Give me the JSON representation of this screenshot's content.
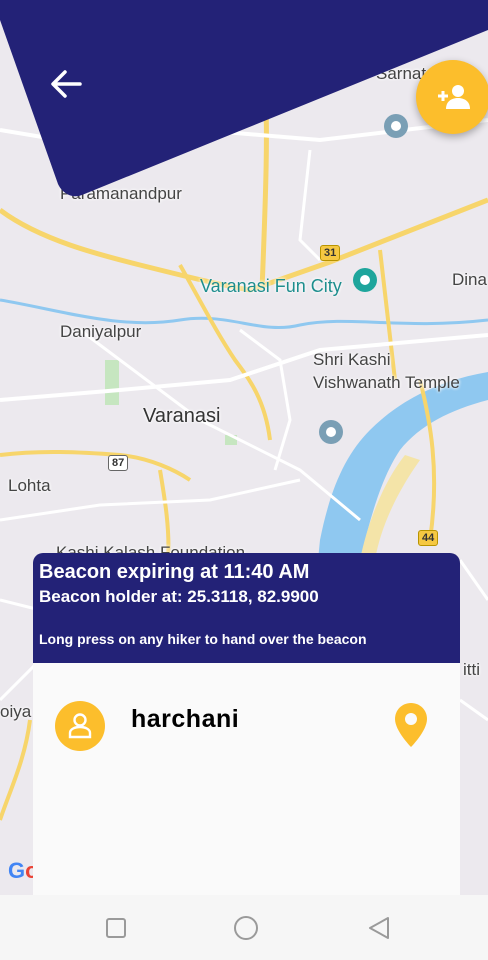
{
  "map": {
    "places": [
      {
        "name": "Sarnath",
        "shown": "Sarnat"
      },
      {
        "name": "Paramanandpur",
        "shown": "Paramanandpur"
      },
      {
        "name": "Varanasi Fun City"
      },
      {
        "name": "Dinapur",
        "shown": "Dina"
      },
      {
        "name": "Daniyalpur"
      },
      {
        "name": "Shri Kashi Vishwanath Temple"
      },
      {
        "name": "Varanasi"
      },
      {
        "name": "Lohta"
      },
      {
        "name": "Kashi Kalash Foundation"
      },
      {
        "name": "Saiya",
        "shown": "oiya"
      },
      {
        "name": "Chitti",
        "shown": "itti"
      }
    ],
    "labels": {
      "sarnath": "Sarnat",
      "paramanandpur": "Paramanandpur",
      "fun_city": "Varanasi Fun City",
      "dina": "Dina",
      "daniyalpur": "Daniyalpur",
      "temple_line1": "Shri Kashi",
      "temple_line2": "Vishwanath Temple",
      "varanasi": "Varanasi",
      "lohta": "Lohta",
      "kashi": "Kashi Kalash Foundation",
      "oiya": "oiya",
      "itti": "itti",
      "shield_31": "31",
      "shield_87": "87",
      "shield_44": "44"
    },
    "attribution_g1": "G",
    "attribution_g2": "o"
  },
  "header": {
    "back_icon": "arrow-left-icon",
    "add_icon": "person-add-icon",
    "color": "#232277"
  },
  "beacon": {
    "expiry_text": "Beacon expiring at 11:40 AM",
    "holder_text": "Beacon holder at: 25.3118, 82.9900",
    "hint_text": "Long press on any hiker to hand over the beacon"
  },
  "hikers": [
    {
      "name": "harchani",
      "avatar_icon": "person-icon",
      "action_icon": "location-pin-icon"
    }
  ],
  "accent_color": "#fcbe2c",
  "navbar": {
    "buttons": [
      "recent-apps",
      "home",
      "back"
    ]
  }
}
